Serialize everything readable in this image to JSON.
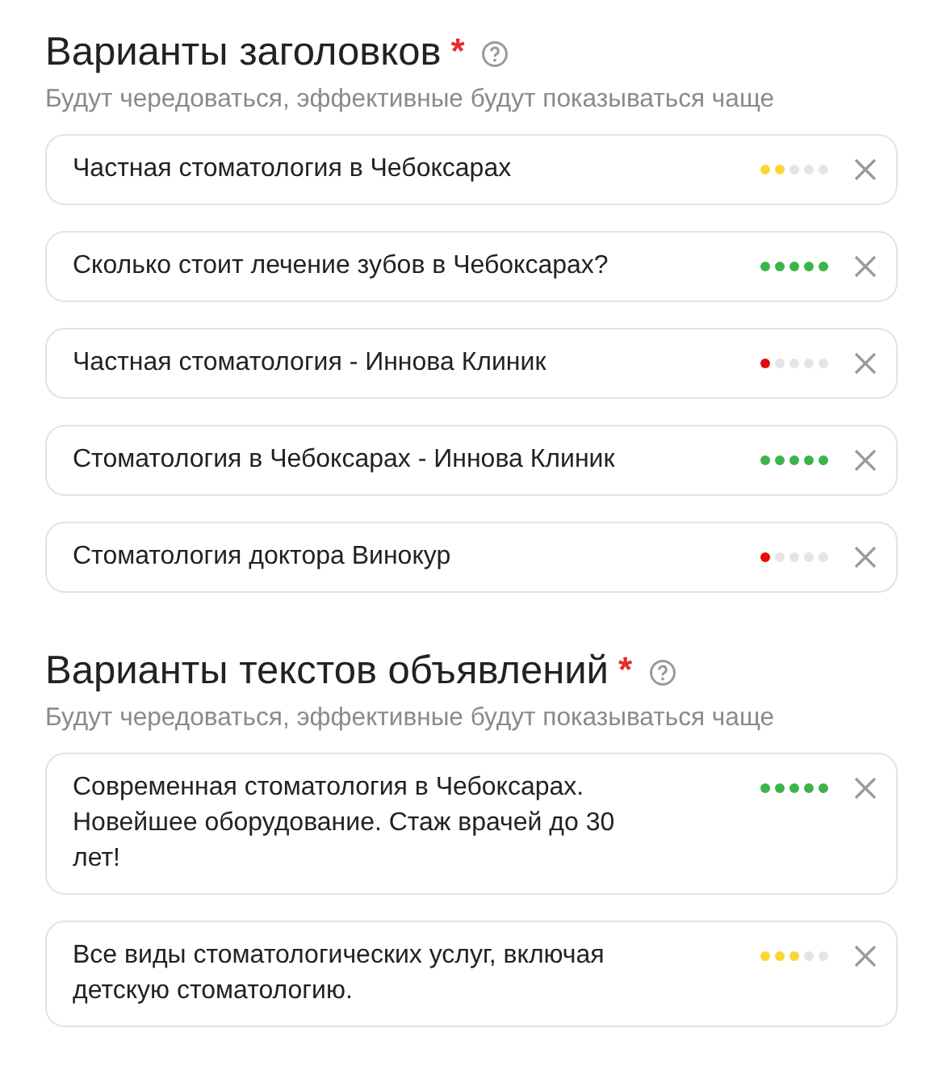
{
  "sections": [
    {
      "title": "Варианты заголовков",
      "required_mark": "*",
      "hint": "Будут чередоваться, эффективные будут показываться чаще",
      "items": [
        {
          "text": "Частная стоматология в Чебоксарах",
          "stars": 2,
          "color": "#fbd630"
        },
        {
          "text": "Сколько стоит лечение зубов в Чебоксарах?",
          "stars": 5,
          "color": "#3bb54a"
        },
        {
          "text": "Частная стоматология - Иннова Клиник",
          "stars": 1,
          "color": "#e00d0d"
        },
        {
          "text": "Стоматология в Чебоксарах - Иннова Клиник",
          "stars": 5,
          "color": "#3bb54a"
        },
        {
          "text": "Стоматология доктора Винокур",
          "stars": 1,
          "color": "#e00d0d"
        }
      ]
    },
    {
      "title": "Варианты текстов объявлений",
      "required_mark": "*",
      "hint": "Будут чередоваться, эффективные будут показываться чаще",
      "items": [
        {
          "text": "Современная стоматология в Чебоксарах. Новейшее оборудование. Стаж врачей до 30 лет!",
          "stars": 5,
          "color": "#3bb54a"
        },
        {
          "text": "Все виды стоматологических услуг, включая детскую стоматологию.",
          "stars": 3,
          "color": "#fbd630"
        }
      ]
    }
  ]
}
